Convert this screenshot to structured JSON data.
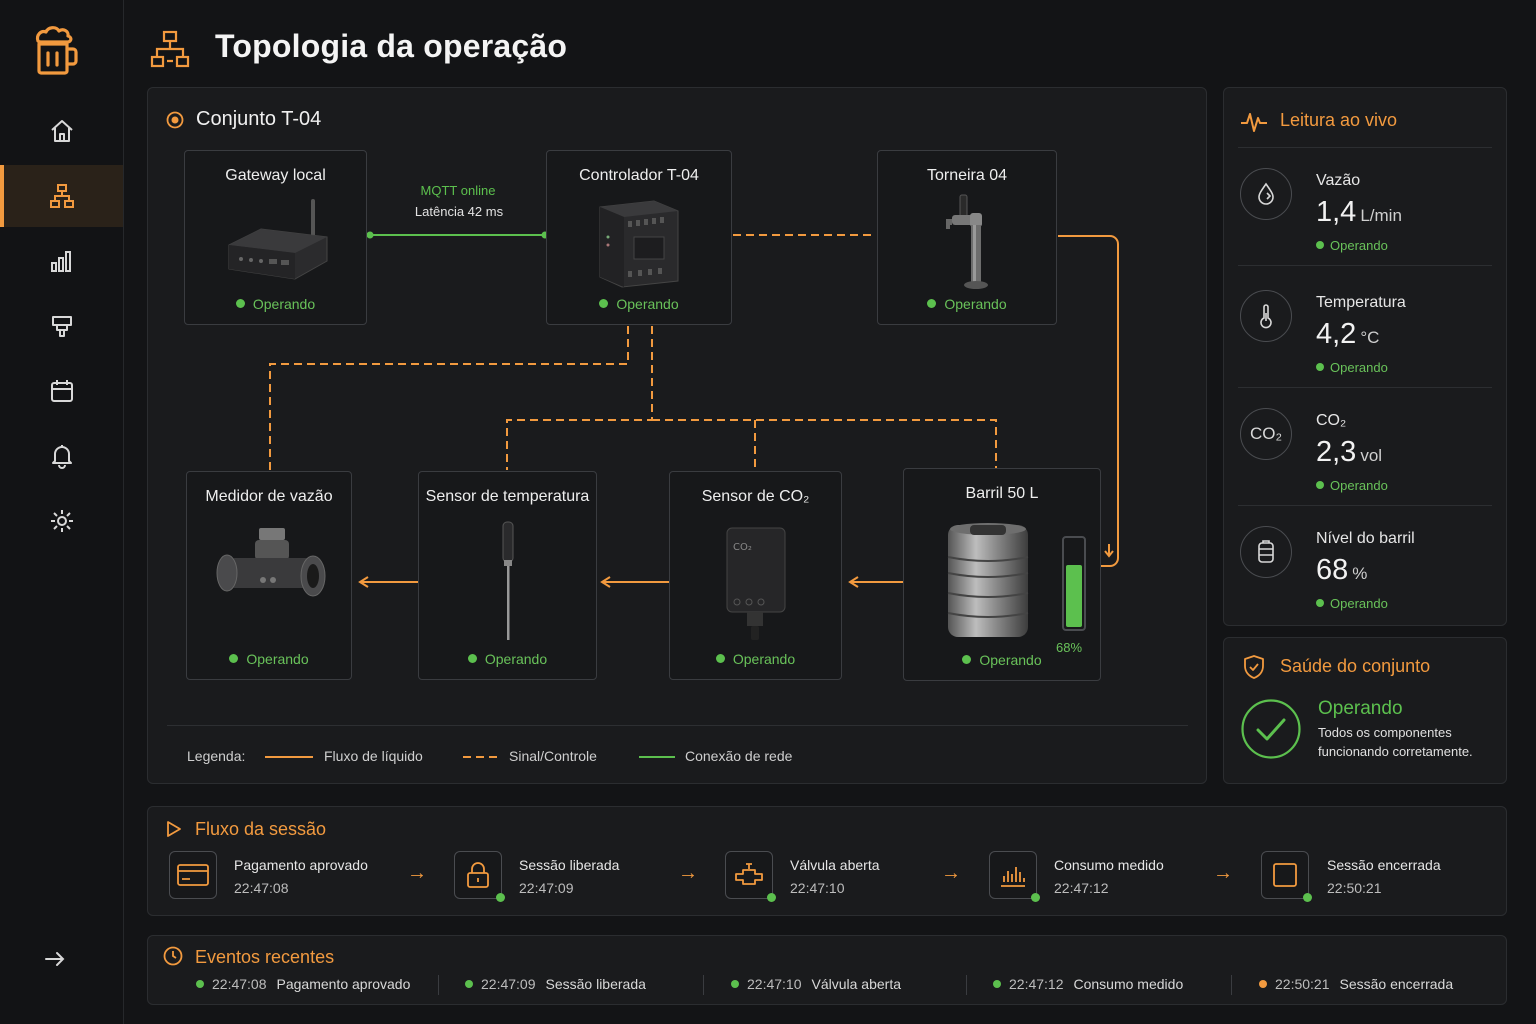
{
  "header": {
    "title": "Topologia da operação"
  },
  "sidebar": {
    "items": [
      {
        "icon": "home-icon"
      },
      {
        "icon": "topology-icon",
        "active": true
      },
      {
        "icon": "bar-chart-icon"
      },
      {
        "icon": "tap-icon"
      },
      {
        "icon": "calendar-icon"
      },
      {
        "icon": "bell-icon"
      },
      {
        "icon": "gear-icon"
      }
    ],
    "collapse_icon": "arrow-right-icon"
  },
  "topology": {
    "title": "Conjunto T-04",
    "link_label": "MQTT online",
    "link_latency": "Latência 42 ms",
    "nodes": {
      "gateway": {
        "title": "Gateway local",
        "status": "Operando"
      },
      "controller": {
        "title": "Controlador T-04",
        "status": "Operando"
      },
      "tap": {
        "title": "Torneira 04",
        "status": "Operando"
      },
      "flow_meter": {
        "title": "Medidor de vazão",
        "status": "Operando"
      },
      "temp_sensor": {
        "title": "Sensor de temperatura",
        "status": "Operando"
      },
      "co2_sensor": {
        "title": "Sensor de CO₂",
        "status": "Operando"
      },
      "keg": {
        "title": "Barril 50 L",
        "status": "Operando",
        "level_label": "68%",
        "level": 0.68
      }
    },
    "legend": {
      "label": "Legenda:",
      "liquid": "Fluxo de líquido",
      "signal": "Sinal/Controle",
      "network": "Conexão de rede"
    }
  },
  "live": {
    "title": "Leitura ao vivo",
    "rows": [
      {
        "label": "Vazão",
        "value": "1,4",
        "unit": "L/min",
        "status": "Operando",
        "icon": "drop-icon"
      },
      {
        "label": "Temperatura",
        "value": "4,2",
        "unit": "°C",
        "status": "Operando",
        "icon": "thermometer-icon"
      },
      {
        "label": "CO₂",
        "value": "2,3",
        "unit": "vol",
        "status": "Operando",
        "icon": "co2-icon",
        "icon_text": "CO₂"
      },
      {
        "label": "Nível do barril",
        "value": "68",
        "unit": "%",
        "status": "Operando",
        "icon": "keg-icon"
      }
    ]
  },
  "health": {
    "title": "Saúde do conjunto",
    "status": "Operando",
    "description_1": "Todos os componentes",
    "description_2": "funcionando corretamente."
  },
  "session": {
    "title": "Fluxo da sessão",
    "steps": [
      {
        "label": "Pagamento aprovado",
        "time": "22:47:08",
        "icon": "card-icon"
      },
      {
        "label": "Sessão liberada",
        "time": "22:47:09",
        "icon": "lock-icon"
      },
      {
        "label": "Válvula aberta",
        "time": "22:47:10",
        "icon": "valve-icon"
      },
      {
        "label": "Consumo medido",
        "time": "22:47:12",
        "icon": "consumption-chart-icon"
      },
      {
        "label": "Sessão encerrada",
        "time": "22:50:21",
        "icon": "stop-icon"
      }
    ]
  },
  "events": {
    "title": "Eventos recentes",
    "items": [
      {
        "time": "22:47:08",
        "label": "Pagamento aprovado",
        "color": "#5cc04e"
      },
      {
        "time": "22:47:09",
        "label": "Sessão liberada",
        "color": "#5cc04e"
      },
      {
        "time": "22:47:10",
        "label": "Válvula aberta",
        "color": "#5cc04e"
      },
      {
        "time": "22:47:12",
        "label": "Consumo medido",
        "color": "#5cc04e"
      },
      {
        "time": "22:50:21",
        "label": "Sessão encerrada",
        "color": "#f29a3f"
      }
    ]
  },
  "colors": {
    "accent": "#f29a3f",
    "ok": "#5cc04e",
    "background": "#131416"
  }
}
